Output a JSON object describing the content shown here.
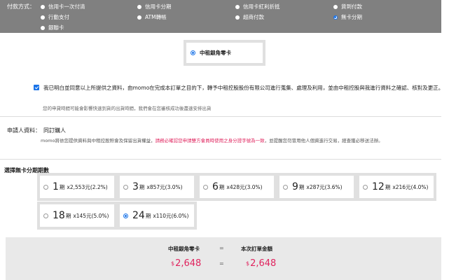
{
  "payment": {
    "label": "付款方式：",
    "options": [
      {
        "label": "信用卡一次付清",
        "selected": false
      },
      {
        "label": "信用卡分期",
        "selected": false
      },
      {
        "label": "信用卡紅利折抵",
        "selected": false
      },
      {
        "label": "貨到付款",
        "selected": false
      },
      {
        "label": "行動支付",
        "selected": false
      },
      {
        "label": "ATM轉帳",
        "selected": false
      },
      {
        "label": "超商付款",
        "selected": false
      },
      {
        "label": "無卡分期",
        "selected": true
      },
      {
        "label": "銀聯卡",
        "selected": false
      }
    ]
  },
  "card": {
    "name": "中租銀角零卡",
    "selected": true
  },
  "agreement": {
    "checked": true,
    "text": "我已明白並同意以上所提供之資料，由momo在完成本訂單之目的下，轉予中租控股股份有限公司進行蒐集、處理及利用，並由中租控股與我進行資料之確認、核對及更正。",
    "note": "您的申貸時間可能會影響快速到貨的出貨時間，我們會在您審核成功後盡速安排出貨"
  },
  "applicant": {
    "label": "申請人資料：",
    "value": "同訂購人",
    "notice_before": "momo將依您提供資料與中租控股照會及保留出貨權益，",
    "notice_warn": "請務必確認您申請雙方會員時使用之身分證字號為一致",
    "notice_after": "，並提醒您勿冒用他人個資進行交易，經查獲必移送法辦。"
  },
  "installments": {
    "title": "選擇無卡分期期數",
    "plans": [
      {
        "periods": "1",
        "unit": "期",
        "detail": "x2,553元(2.2%)",
        "selected": false
      },
      {
        "periods": "3",
        "unit": "期",
        "detail": "x857元(3.0%)",
        "selected": false
      },
      {
        "periods": "6",
        "unit": "期",
        "detail": "x428元(3.0%)",
        "selected": false
      },
      {
        "periods": "9",
        "unit": "期",
        "detail": "x287元(3.6%)",
        "selected": false
      },
      {
        "periods": "12",
        "unit": "期",
        "detail": "x216元(4.0%)",
        "selected": false
      },
      {
        "periods": "18",
        "unit": "期",
        "detail": "x145元(5.0%)",
        "selected": false
      },
      {
        "periods": "24",
        "unit": "期",
        "detail": "x110元(6.0%)",
        "selected": true
      }
    ]
  },
  "totals": {
    "left_label": "中租銀角零卡",
    "right_label": "本次訂單金額",
    "equals": "=",
    "currency": "$",
    "left_amount": "2,648",
    "right_amount": "2,648"
  },
  "colors": {
    "accent": "#1a73e8",
    "price": "#e0245e",
    "bar": "#808080"
  }
}
